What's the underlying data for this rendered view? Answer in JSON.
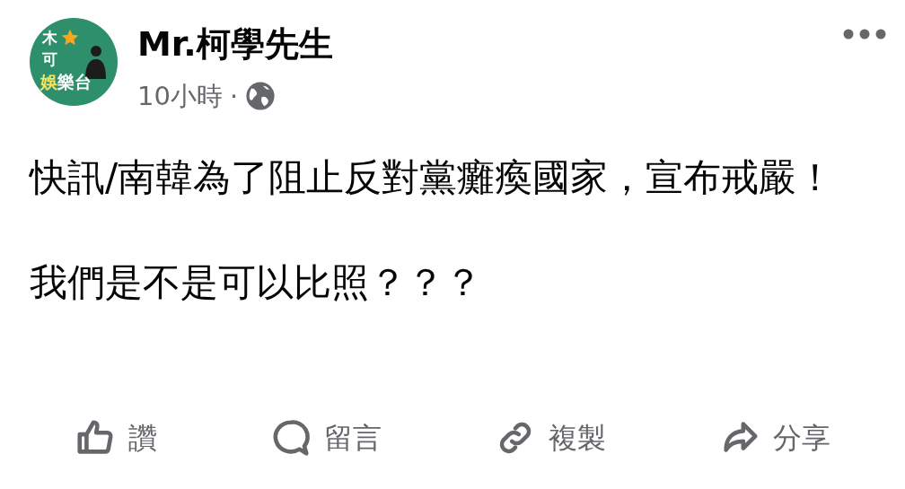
{
  "avatar": {
    "lines": [
      {
        "text": "木",
        "color": "#ffffff"
      },
      {
        "text": "可",
        "color": "#ffffff"
      },
      {
        "text": "娛",
        "color": "#f5e663"
      },
      {
        "text": "樂台",
        "color": "#ffffff"
      }
    ]
  },
  "author": "Mr.柯學先生",
  "time": "10小時",
  "separator": "·",
  "paragraphs": [
    "快訊/南韓為了阻止反對黨癱瘓國家，宣布戒嚴！",
    "我們是不是可以比照？？？"
  ],
  "actions": [
    {
      "kind": "like",
      "label": "讚"
    },
    {
      "kind": "comment",
      "label": "留言"
    },
    {
      "kind": "copy",
      "label": "複製"
    },
    {
      "kind": "share",
      "label": "分享"
    }
  ]
}
